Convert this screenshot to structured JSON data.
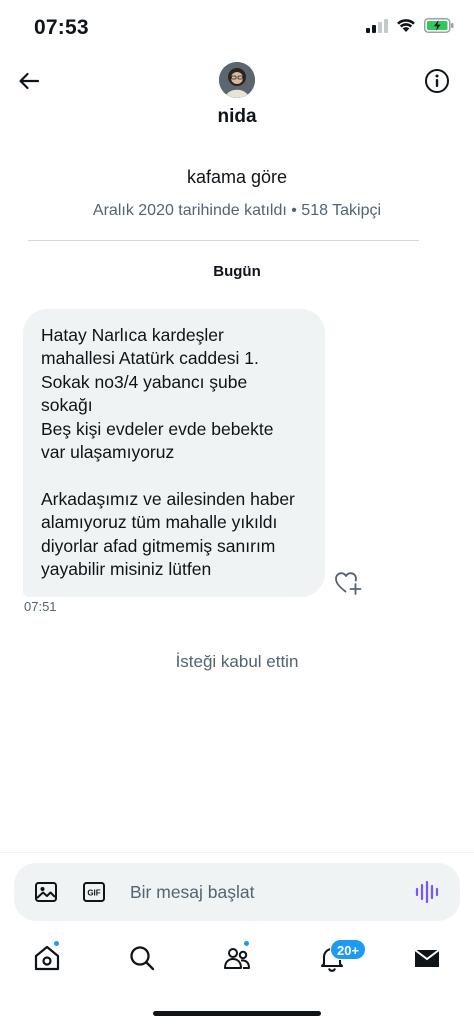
{
  "status_bar": {
    "time": "07:53"
  },
  "header": {
    "name": "nida"
  },
  "profile": {
    "bio": "kafama göre",
    "meta": "Aralık 2020 tarihinde katıldı • 518 Takipçi"
  },
  "conversation": {
    "date_label": "Bugün",
    "message": {
      "paragraph1": "Hatay Narlıca kardeşler\nmahallesi Atatürk caddesi 1.\nSokak no3/4 yabancı şube\nsokağı\nBeş kişi evdeler evde bebekte\nvar ulaşamıyoruz",
      "paragraph2": "Arkadaşımız ve ailesinden haber\nalamıyoruz tüm mahalle yıkıldı\ndiyorlar afad gitmemiş sanırım\nyayabilir misiniz lütfen",
      "time": "07:51"
    },
    "accepted_text": "İsteği kabul ettin"
  },
  "composer": {
    "placeholder": "Bir mesaj başlat",
    "gif_label": "GIF"
  },
  "tab_bar": {
    "items": [
      {
        "icon": "home-icon",
        "has_dot": true
      },
      {
        "icon": "search-icon",
        "has_dot": false
      },
      {
        "icon": "communities-icon",
        "has_dot": true
      },
      {
        "icon": "notifications-icon",
        "badge": "20+"
      },
      {
        "icon": "messages-icon",
        "has_dot": false
      }
    ]
  },
  "colors": {
    "accent": "#1d9bf0",
    "voice": "#7856ff",
    "bubble": "#eff3f4",
    "secondary_text": "#536471"
  }
}
